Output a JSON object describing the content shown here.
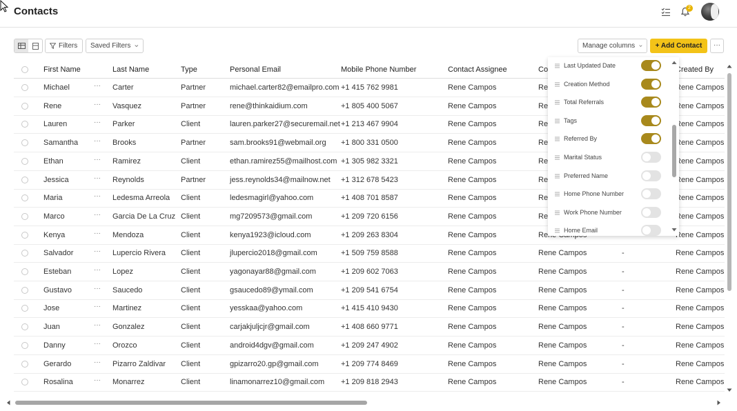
{
  "header": {
    "title": "Contacts",
    "notification_count": "2",
    "icons": [
      "tasks-icon",
      "bell-icon",
      "avatar"
    ]
  },
  "toolbar": {
    "filters_label": "Filters",
    "saved_filters_label": "Saved Filters",
    "manage_columns_label": "Manage columns",
    "add_contact_label": "+ Add Contact",
    "more_label": "···",
    "accent_color": "#f3c318"
  },
  "table": {
    "columns": [
      "First Name",
      "Last Name",
      "Type",
      "Personal Email",
      "Mobile Phone Number",
      "Contact Assignee",
      "Co",
      "Created By"
    ],
    "rows": [
      {
        "first": "Michael",
        "last": "Carter",
        "type": "Partner",
        "email": "michael.carter82@emailpro.com",
        "phone": "+1 415 762 9981",
        "assignee": "Rene Campos",
        "co": "Re",
        "dash": "",
        "created": "Rene Campos"
      },
      {
        "first": "Rene",
        "last": "Vasquez",
        "type": "Partner",
        "email": "rene@thinkaidium.com",
        "phone": "+1 805 400 5067",
        "assignee": "Rene Campos",
        "co": "Re",
        "dash": "",
        "created": "Rene Campos"
      },
      {
        "first": "Lauren",
        "last": "Parker",
        "type": "Client",
        "email": "lauren.parker27@securemail.net",
        "phone": "+1 213 467 9904",
        "assignee": "Rene Campos",
        "co": "Re",
        "dash": "",
        "created": "Rene Campos"
      },
      {
        "first": "Samantha",
        "last": "Brooks",
        "type": "Partner",
        "email": "sam.brooks91@webmail.org",
        "phone": "+1 800 331 0500",
        "assignee": "Rene Campos",
        "co": "Re",
        "dash": "",
        "created": "Rene Campos"
      },
      {
        "first": "Ethan",
        "last": "Ramirez",
        "type": "Client",
        "email": "ethan.ramirez55@mailhost.com",
        "phone": "+1 305 982 3321",
        "assignee": "Rene Campos",
        "co": "Re",
        "dash": "",
        "created": "Rene Campos"
      },
      {
        "first": "Jessica",
        "last": "Reynolds",
        "type": "Partner",
        "email": "jess.reynolds34@mailnow.net",
        "phone": "+1 312 678 5423",
        "assignee": "Rene Campos",
        "co": "Re",
        "dash": "",
        "created": "Rene Campos"
      },
      {
        "first": "Maria",
        "last": "Ledesma Arreola",
        "type": "Client",
        "email": "ledesmagirl@yahoo.com",
        "phone": "+1 408 701 8587",
        "assignee": "Rene Campos",
        "co": "Re",
        "dash": "",
        "created": "Rene Campos"
      },
      {
        "first": "Marco",
        "last": "Garcia De La Cruz",
        "type": "Client",
        "email": "mg7209573@gmail.com",
        "phone": "+1 209 720 6156",
        "assignee": "Rene Campos",
        "co": "Re",
        "dash": "",
        "created": "Rene Campos"
      },
      {
        "first": "Kenya",
        "last": "Mendoza",
        "type": "Client",
        "email": "kenya1923@icloud.com",
        "phone": "+1 209 263 8304",
        "assignee": "Rene Campos",
        "co": "Rene Campos",
        "dash": "",
        "created": "Rene Campos"
      },
      {
        "first": "Salvador",
        "last": "Lupercio Rivera",
        "type": "Client",
        "email": "jlupercio2018@gmail.com",
        "phone": "+1 509 759 8588",
        "assignee": "Rene Campos",
        "co": "Rene Campos",
        "dash": "-",
        "created": "Rene Campos"
      },
      {
        "first": "Esteban",
        "last": "Lopez",
        "type": "Client",
        "email": "yagonayar88@gmail.com",
        "phone": "+1 209 602 7063",
        "assignee": "Rene Campos",
        "co": "Rene Campos",
        "dash": "-",
        "created": "Rene Campos"
      },
      {
        "first": "Gustavo",
        "last": "Saucedo",
        "type": "Client",
        "email": "gsaucedo89@ymail.com",
        "phone": "+1 209 541 6754",
        "assignee": "Rene Campos",
        "co": "Rene Campos",
        "dash": "-",
        "created": "Rene Campos"
      },
      {
        "first": "Jose",
        "last": "Martinez",
        "type": "Client",
        "email": "yesskaa@yahoo.com",
        "phone": "+1 415 410 9430",
        "assignee": "Rene Campos",
        "co": "Rene Campos",
        "dash": "-",
        "created": "Rene Campos"
      },
      {
        "first": "Juan",
        "last": "Gonzalez",
        "type": "Client",
        "email": "carjakjuljcjr@gmail.com",
        "phone": "+1 408 660 9771",
        "assignee": "Rene Campos",
        "co": "Rene Campos",
        "dash": "-",
        "created": "Rene Campos"
      },
      {
        "first": "Danny",
        "last": "Orozco",
        "type": "Client",
        "email": "android4dgv@gmail.com",
        "phone": "+1 209 247 4902",
        "assignee": "Rene Campos",
        "co": "Rene Campos",
        "dash": "-",
        "created": "Rene Campos"
      },
      {
        "first": "Gerardo",
        "last": "Pizarro Zaldivar",
        "type": "Client",
        "email": "gpizarro20.gp@gmail.com",
        "phone": "+1 209 774 8469",
        "assignee": "Rene Campos",
        "co": "Rene Campos",
        "dash": "-",
        "created": "Rene Campos"
      },
      {
        "first": "Rosalina",
        "last": "Monarrez",
        "type": "Client",
        "email": "linamonarrez10@gmail.com",
        "phone": "+1 209 818 2943",
        "assignee": "Rene Campos",
        "co": "Rene Campos",
        "dash": "-",
        "created": "Rene Campos"
      }
    ]
  },
  "column_panel": {
    "items": [
      {
        "label": "Last Updated Date",
        "on": true
      },
      {
        "label": "Creation Method",
        "on": true
      },
      {
        "label": "Total Referrals",
        "on": true
      },
      {
        "label": "Tags",
        "on": true
      },
      {
        "label": "Referred By",
        "on": true
      },
      {
        "label": "Marital Status",
        "on": false
      },
      {
        "label": "Preferred Name",
        "on": false
      },
      {
        "label": "Home Phone Number",
        "on": false
      },
      {
        "label": "Work Phone Number",
        "on": false
      },
      {
        "label": "Home Email",
        "on": false
      }
    ],
    "toggle_on_color": "#a8891c"
  }
}
